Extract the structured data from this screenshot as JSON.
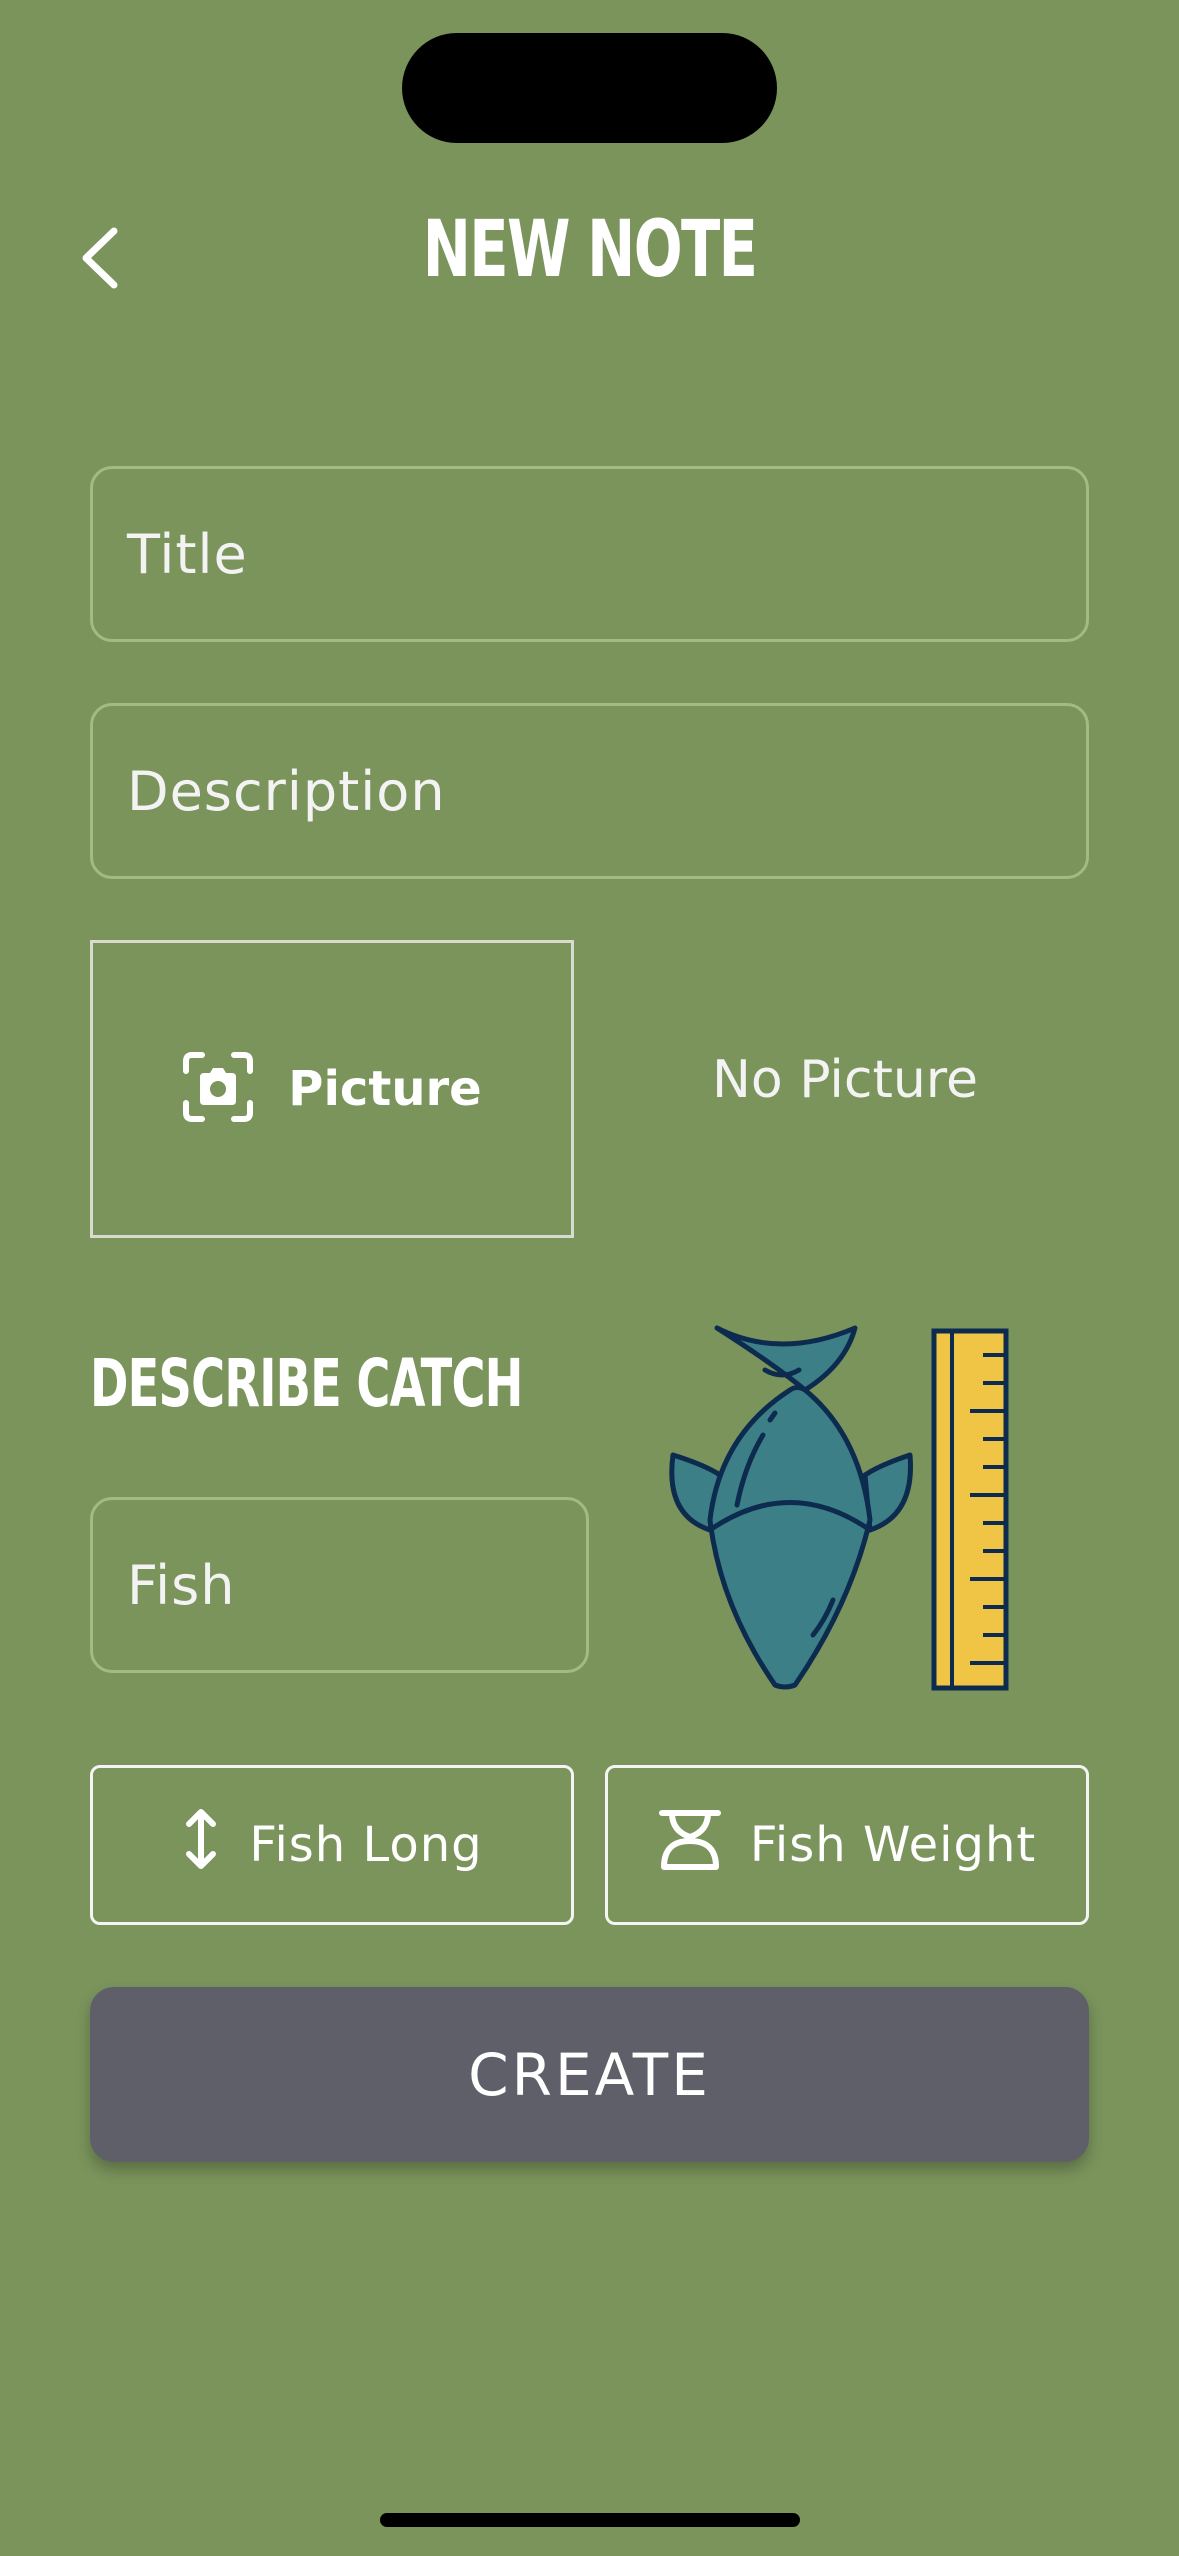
{
  "header": {
    "title": "NEW NOTE",
    "back_icon": "chevron-left-icon"
  },
  "form": {
    "title_placeholder": "Title",
    "description_placeholder": "Description",
    "picture_button_label": "Picture",
    "picture_icon": "camera-icon",
    "no_picture_text": "No Picture"
  },
  "catch": {
    "section_title": "DESCRIBE CATCH",
    "fish_placeholder": "Fish",
    "illustration": "fish-with-ruler-icon",
    "fish_long_label": "Fish Long",
    "fish_long_icon": "vertical-arrows-icon",
    "fish_weight_label": "Fish Weight",
    "fish_weight_icon": "scale-icon"
  },
  "actions": {
    "create_label": "CREATE"
  },
  "colors": {
    "background": "#7a945c",
    "field_border": "#a2bb7f",
    "create_button": "#5f5f69",
    "fish_body": "#3d7f87",
    "ruler": "#f0c445",
    "outline": "#0d2b4f"
  }
}
